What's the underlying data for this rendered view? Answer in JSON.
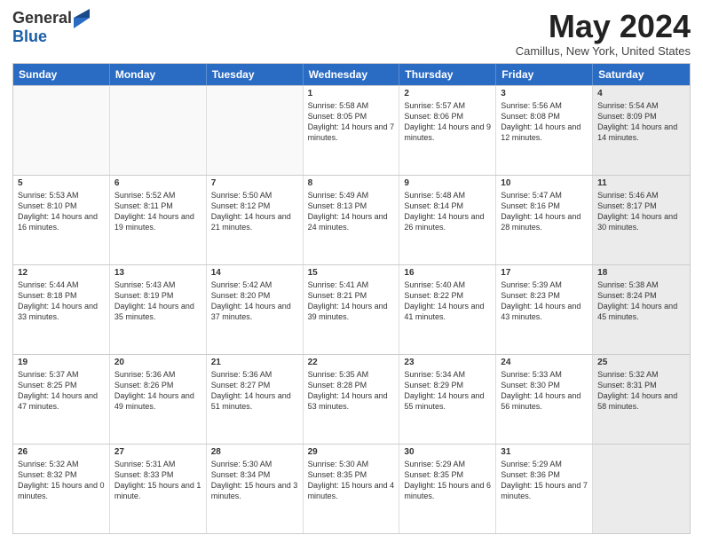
{
  "logo": {
    "general": "General",
    "blue": "Blue"
  },
  "title": "May 2024",
  "location": "Camillus, New York, United States",
  "headers": [
    "Sunday",
    "Monday",
    "Tuesday",
    "Wednesday",
    "Thursday",
    "Friday",
    "Saturday"
  ],
  "rows": [
    [
      {
        "day": "",
        "text": "",
        "empty": true
      },
      {
        "day": "",
        "text": "",
        "empty": true
      },
      {
        "day": "",
        "text": "",
        "empty": true
      },
      {
        "day": "1",
        "text": "Sunrise: 5:58 AM\nSunset: 8:05 PM\nDaylight: 14 hours\nand 7 minutes.",
        "empty": false
      },
      {
        "day": "2",
        "text": "Sunrise: 5:57 AM\nSunset: 8:06 PM\nDaylight: 14 hours\nand 9 minutes.",
        "empty": false
      },
      {
        "day": "3",
        "text": "Sunrise: 5:56 AM\nSunset: 8:08 PM\nDaylight: 14 hours\nand 12 minutes.",
        "empty": false
      },
      {
        "day": "4",
        "text": "Sunrise: 5:54 AM\nSunset: 8:09 PM\nDaylight: 14 hours\nand 14 minutes.",
        "empty": false,
        "shaded": true
      }
    ],
    [
      {
        "day": "5",
        "text": "Sunrise: 5:53 AM\nSunset: 8:10 PM\nDaylight: 14 hours\nand 16 minutes.",
        "empty": false
      },
      {
        "day": "6",
        "text": "Sunrise: 5:52 AM\nSunset: 8:11 PM\nDaylight: 14 hours\nand 19 minutes.",
        "empty": false
      },
      {
        "day": "7",
        "text": "Sunrise: 5:50 AM\nSunset: 8:12 PM\nDaylight: 14 hours\nand 21 minutes.",
        "empty": false
      },
      {
        "day": "8",
        "text": "Sunrise: 5:49 AM\nSunset: 8:13 PM\nDaylight: 14 hours\nand 24 minutes.",
        "empty": false
      },
      {
        "day": "9",
        "text": "Sunrise: 5:48 AM\nSunset: 8:14 PM\nDaylight: 14 hours\nand 26 minutes.",
        "empty": false
      },
      {
        "day": "10",
        "text": "Sunrise: 5:47 AM\nSunset: 8:16 PM\nDaylight: 14 hours\nand 28 minutes.",
        "empty": false
      },
      {
        "day": "11",
        "text": "Sunrise: 5:46 AM\nSunset: 8:17 PM\nDaylight: 14 hours\nand 30 minutes.",
        "empty": false,
        "shaded": true
      }
    ],
    [
      {
        "day": "12",
        "text": "Sunrise: 5:44 AM\nSunset: 8:18 PM\nDaylight: 14 hours\nand 33 minutes.",
        "empty": false
      },
      {
        "day": "13",
        "text": "Sunrise: 5:43 AM\nSunset: 8:19 PM\nDaylight: 14 hours\nand 35 minutes.",
        "empty": false
      },
      {
        "day": "14",
        "text": "Sunrise: 5:42 AM\nSunset: 8:20 PM\nDaylight: 14 hours\nand 37 minutes.",
        "empty": false
      },
      {
        "day": "15",
        "text": "Sunrise: 5:41 AM\nSunset: 8:21 PM\nDaylight: 14 hours\nand 39 minutes.",
        "empty": false
      },
      {
        "day": "16",
        "text": "Sunrise: 5:40 AM\nSunset: 8:22 PM\nDaylight: 14 hours\nand 41 minutes.",
        "empty": false
      },
      {
        "day": "17",
        "text": "Sunrise: 5:39 AM\nSunset: 8:23 PM\nDaylight: 14 hours\nand 43 minutes.",
        "empty": false
      },
      {
        "day": "18",
        "text": "Sunrise: 5:38 AM\nSunset: 8:24 PM\nDaylight: 14 hours\nand 45 minutes.",
        "empty": false,
        "shaded": true
      }
    ],
    [
      {
        "day": "19",
        "text": "Sunrise: 5:37 AM\nSunset: 8:25 PM\nDaylight: 14 hours\nand 47 minutes.",
        "empty": false
      },
      {
        "day": "20",
        "text": "Sunrise: 5:36 AM\nSunset: 8:26 PM\nDaylight: 14 hours\nand 49 minutes.",
        "empty": false
      },
      {
        "day": "21",
        "text": "Sunrise: 5:36 AM\nSunset: 8:27 PM\nDaylight: 14 hours\nand 51 minutes.",
        "empty": false
      },
      {
        "day": "22",
        "text": "Sunrise: 5:35 AM\nSunset: 8:28 PM\nDaylight: 14 hours\nand 53 minutes.",
        "empty": false
      },
      {
        "day": "23",
        "text": "Sunrise: 5:34 AM\nSunset: 8:29 PM\nDaylight: 14 hours\nand 55 minutes.",
        "empty": false
      },
      {
        "day": "24",
        "text": "Sunrise: 5:33 AM\nSunset: 8:30 PM\nDaylight: 14 hours\nand 56 minutes.",
        "empty": false
      },
      {
        "day": "25",
        "text": "Sunrise: 5:32 AM\nSunset: 8:31 PM\nDaylight: 14 hours\nand 58 minutes.",
        "empty": false,
        "shaded": true
      }
    ],
    [
      {
        "day": "26",
        "text": "Sunrise: 5:32 AM\nSunset: 8:32 PM\nDaylight: 15 hours\nand 0 minutes.",
        "empty": false
      },
      {
        "day": "27",
        "text": "Sunrise: 5:31 AM\nSunset: 8:33 PM\nDaylight: 15 hours\nand 1 minute.",
        "empty": false
      },
      {
        "day": "28",
        "text": "Sunrise: 5:30 AM\nSunset: 8:34 PM\nDaylight: 15 hours\nand 3 minutes.",
        "empty": false
      },
      {
        "day": "29",
        "text": "Sunrise: 5:30 AM\nSunset: 8:35 PM\nDaylight: 15 hours\nand 4 minutes.",
        "empty": false
      },
      {
        "day": "30",
        "text": "Sunrise: 5:29 AM\nSunset: 8:35 PM\nDaylight: 15 hours\nand 6 minutes.",
        "empty": false
      },
      {
        "day": "31",
        "text": "Sunrise: 5:29 AM\nSunset: 8:36 PM\nDaylight: 15 hours\nand 7 minutes.",
        "empty": false
      },
      {
        "day": "",
        "text": "",
        "empty": true,
        "shaded": true
      }
    ]
  ]
}
